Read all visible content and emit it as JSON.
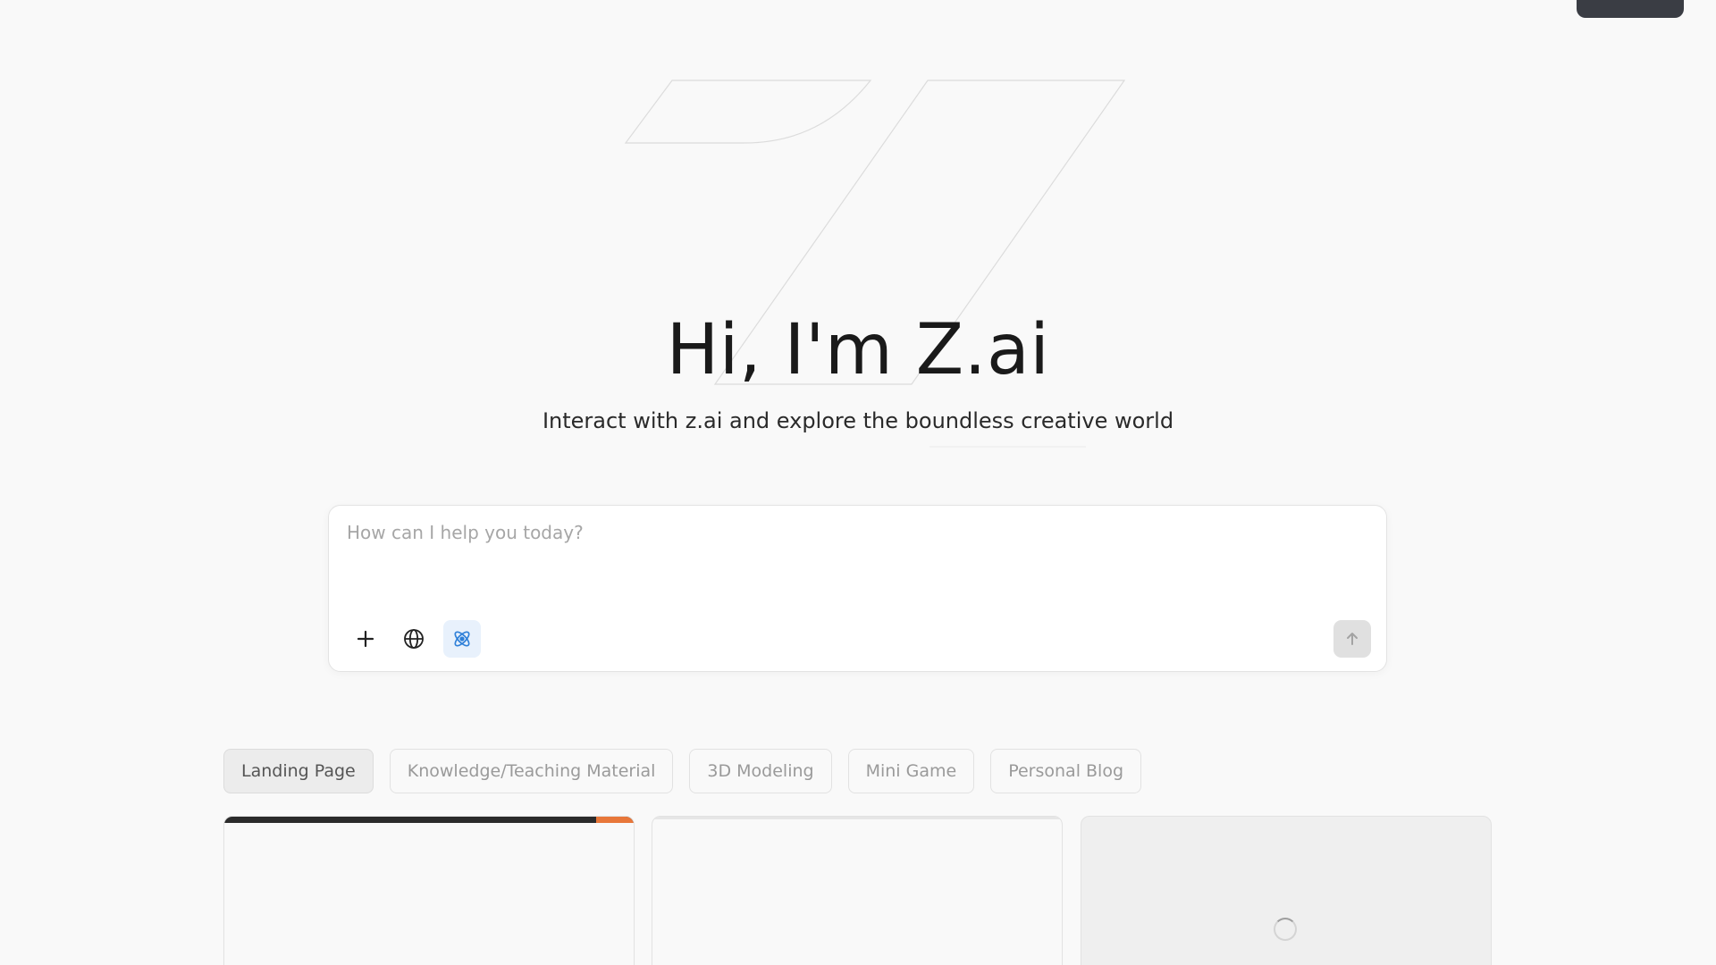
{
  "hero": {
    "title": "Hi, I'm Z.ai",
    "subtitle": "Interact with z.ai and explore the boundless creative world"
  },
  "composer": {
    "placeholder": "How can I help you today?",
    "value": "",
    "tools": [
      {
        "icon": "plus-icon",
        "active": false
      },
      {
        "icon": "globe-icon",
        "active": false
      },
      {
        "icon": "atom-icon",
        "active": true
      }
    ],
    "send_icon": "arrow-up-icon"
  },
  "categories": [
    {
      "label": "Landing Page",
      "active": true
    },
    {
      "label": "Knowledge/Teaching Material",
      "active": false
    },
    {
      "label": "3D Modeling",
      "active": false
    },
    {
      "label": "Mini Game",
      "active": false
    },
    {
      "label": "Personal Blog",
      "active": false
    }
  ],
  "colors": {
    "background": "#f9f9f9",
    "active_tool_bg": "#e8f1fc",
    "active_tool_icon": "#2f80d8",
    "card_accent": "#e8773a"
  }
}
